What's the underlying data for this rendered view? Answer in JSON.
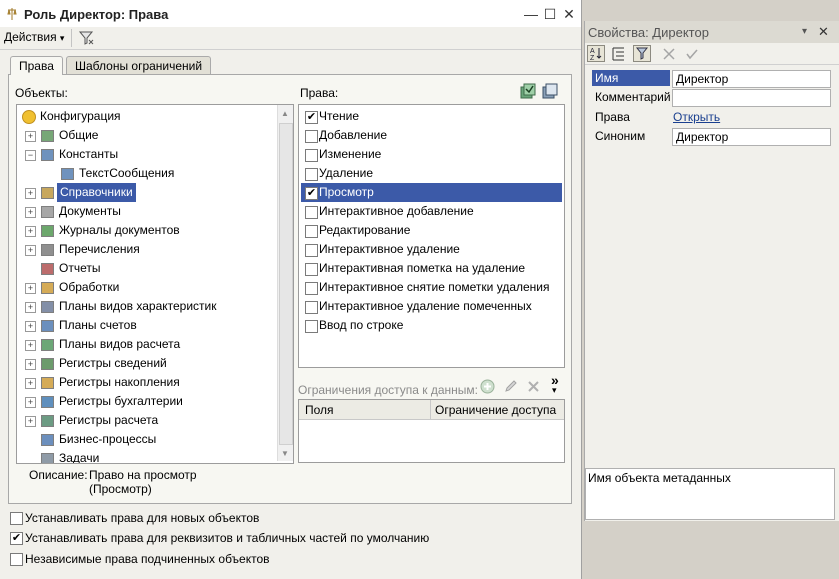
{
  "window": {
    "title": "Роль Директор: Права",
    "minimize": "—",
    "maximize": "☐",
    "close": "✕"
  },
  "toolbar": {
    "actions_label": "Действия",
    "actions_arrow": "▾"
  },
  "tabs": [
    {
      "label": "Права",
      "active": true
    },
    {
      "label": "Шаблоны ограничений",
      "active": false
    }
  ],
  "objects": {
    "label": "Объекты:",
    "items": [
      {
        "label": "Конфигурация",
        "level": 0,
        "expand": "",
        "icon": "config-icon"
      },
      {
        "label": "Общие",
        "level": 1,
        "expand": "+",
        "icon": "common-icon"
      },
      {
        "label": "Константы",
        "level": 1,
        "expand": "−",
        "icon": "constants-icon"
      },
      {
        "label": "ТекстСообщения",
        "level": 2,
        "expand": "",
        "icon": "constant-icon"
      },
      {
        "label": "Справочники",
        "level": 1,
        "expand": "+",
        "icon": "catalogs-icon",
        "selected": true
      },
      {
        "label": "Документы",
        "level": 1,
        "expand": "+",
        "icon": "documents-icon"
      },
      {
        "label": "Журналы документов",
        "level": 1,
        "expand": "+",
        "icon": "journals-icon"
      },
      {
        "label": "Перечисления",
        "level": 1,
        "expand": "+",
        "icon": "enums-icon"
      },
      {
        "label": "Отчеты",
        "level": 1,
        "expand": "",
        "icon": "reports-icon"
      },
      {
        "label": "Обработки",
        "level": 1,
        "expand": "+",
        "icon": "processing-icon"
      },
      {
        "label": "Планы видов характеристик",
        "level": 1,
        "expand": "+",
        "icon": "chart-char-icon"
      },
      {
        "label": "Планы счетов",
        "level": 1,
        "expand": "+",
        "icon": "chart-accounts-icon"
      },
      {
        "label": "Планы видов расчета",
        "level": 1,
        "expand": "+",
        "icon": "chart-calc-icon"
      },
      {
        "label": "Регистры сведений",
        "level": 1,
        "expand": "+",
        "icon": "info-reg-icon"
      },
      {
        "label": "Регистры накопления",
        "level": 1,
        "expand": "+",
        "icon": "accum-reg-icon"
      },
      {
        "label": "Регистры бухгалтерии",
        "level": 1,
        "expand": "+",
        "icon": "acc-reg-icon"
      },
      {
        "label": "Регистры расчета",
        "level": 1,
        "expand": "+",
        "icon": "calc-reg-icon"
      },
      {
        "label": "Бизнес-процессы",
        "level": 1,
        "expand": "",
        "icon": "bp-icon"
      },
      {
        "label": "Задачи",
        "level": 1,
        "expand": "",
        "icon": "tasks-icon"
      }
    ]
  },
  "rights": {
    "label": "Права:",
    "items": [
      {
        "label": "Чтение",
        "checked": true
      },
      {
        "label": "Добавление",
        "checked": false
      },
      {
        "label": "Изменение",
        "checked": false
      },
      {
        "label": "Удаление",
        "checked": false
      },
      {
        "label": "Просмотр",
        "checked": true,
        "selected": true
      },
      {
        "label": "Интерактивное добавление",
        "checked": false
      },
      {
        "label": "Редактирование",
        "checked": false
      },
      {
        "label": "Интерактивное удаление",
        "checked": false
      },
      {
        "label": "Интерактивная пометка на удаление",
        "checked": false
      },
      {
        "label": "Интерактивное снятие пометки удаления",
        "checked": false
      },
      {
        "label": "Интерактивное удаление помеченных",
        "checked": false
      },
      {
        "label": "Ввод по строке",
        "checked": false
      }
    ]
  },
  "limits": {
    "label": "Ограничения доступа к данным:",
    "col_fields": "Поля",
    "col_restriction": "Ограничение доступа",
    "more": "»"
  },
  "description": {
    "label": "Описание:",
    "line1": "Право на просмотр",
    "line2": "(Просмотр)"
  },
  "options": [
    {
      "label": "Устанавливать права для новых объектов",
      "checked": false
    },
    {
      "label": "Устанавливать права для реквизитов и табличных частей по умолчанию",
      "checked": true
    },
    {
      "label": "Независимые права подчиненных объектов",
      "checked": false
    }
  ],
  "properties": {
    "title": "Свойства: Директор",
    "pin": "▾",
    "close": "✕",
    "rows": [
      {
        "label": "Имя",
        "value": "Директор",
        "selected": true
      },
      {
        "label": "Комментарий",
        "value": ""
      },
      {
        "label": "Права",
        "value": "Открыть",
        "link": true
      },
      {
        "label": "Синоним",
        "value": "Директор"
      }
    ],
    "hint": "Имя объекта метаданных"
  },
  "check_mark": "✔",
  "colors": {
    "selection": "#3c5aa8",
    "link": "#1a3f8f"
  }
}
